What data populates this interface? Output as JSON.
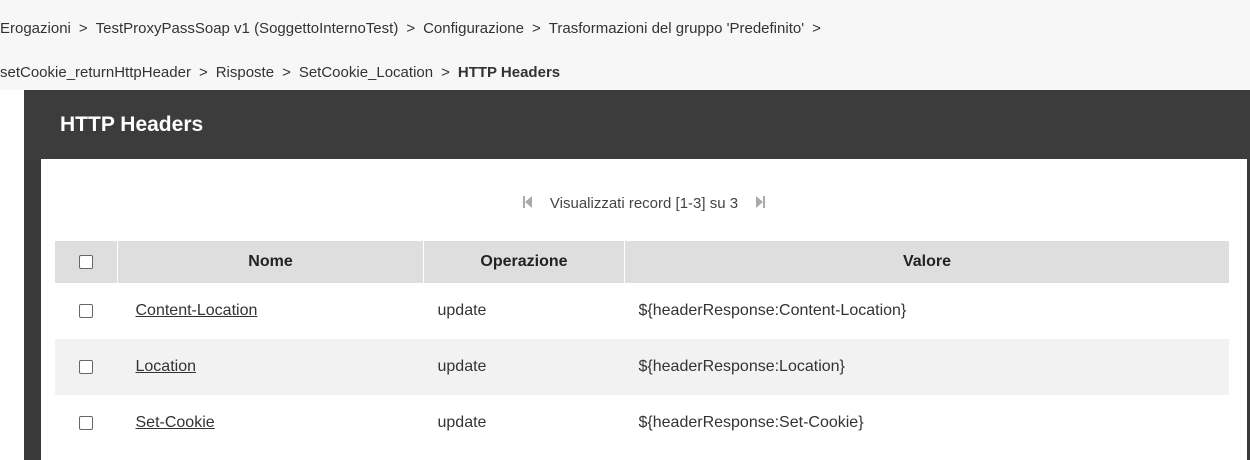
{
  "breadcrumb": {
    "line1": [
      "Erogazioni",
      "TestProxyPassSoap v1 (SoggettoInternoTest)",
      "Configurazione",
      "Trasformazioni del gruppo 'Predefinito'"
    ],
    "line2": [
      "setCookie_returnHttpHeader",
      "Risposte",
      "SetCookie_Location"
    ],
    "current": "HTTP Headers",
    "separator": ">"
  },
  "panel": {
    "title": "HTTP Headers"
  },
  "pager": {
    "text": "Visualizzati record [1-3] su 3",
    "first_icon": "first-page-icon",
    "last_icon": "last-page-icon"
  },
  "table": {
    "columns": [
      "Nome",
      "Operazione",
      "Valore"
    ],
    "rows": [
      {
        "nome": "Content-Location",
        "operazione": "update",
        "valore": "${headerResponse:Content-Location}"
      },
      {
        "nome": "Location",
        "operazione": "update",
        "valore": "${headerResponse:Location}"
      },
      {
        "nome": "Set-Cookie",
        "operazione": "update",
        "valore": "${headerResponse:Set-Cookie}"
      }
    ]
  },
  "colors": {
    "header_bg": "#3c3c3c",
    "table_header_bg": "#dedede",
    "alt_row_bg": "#f2f2f2"
  }
}
